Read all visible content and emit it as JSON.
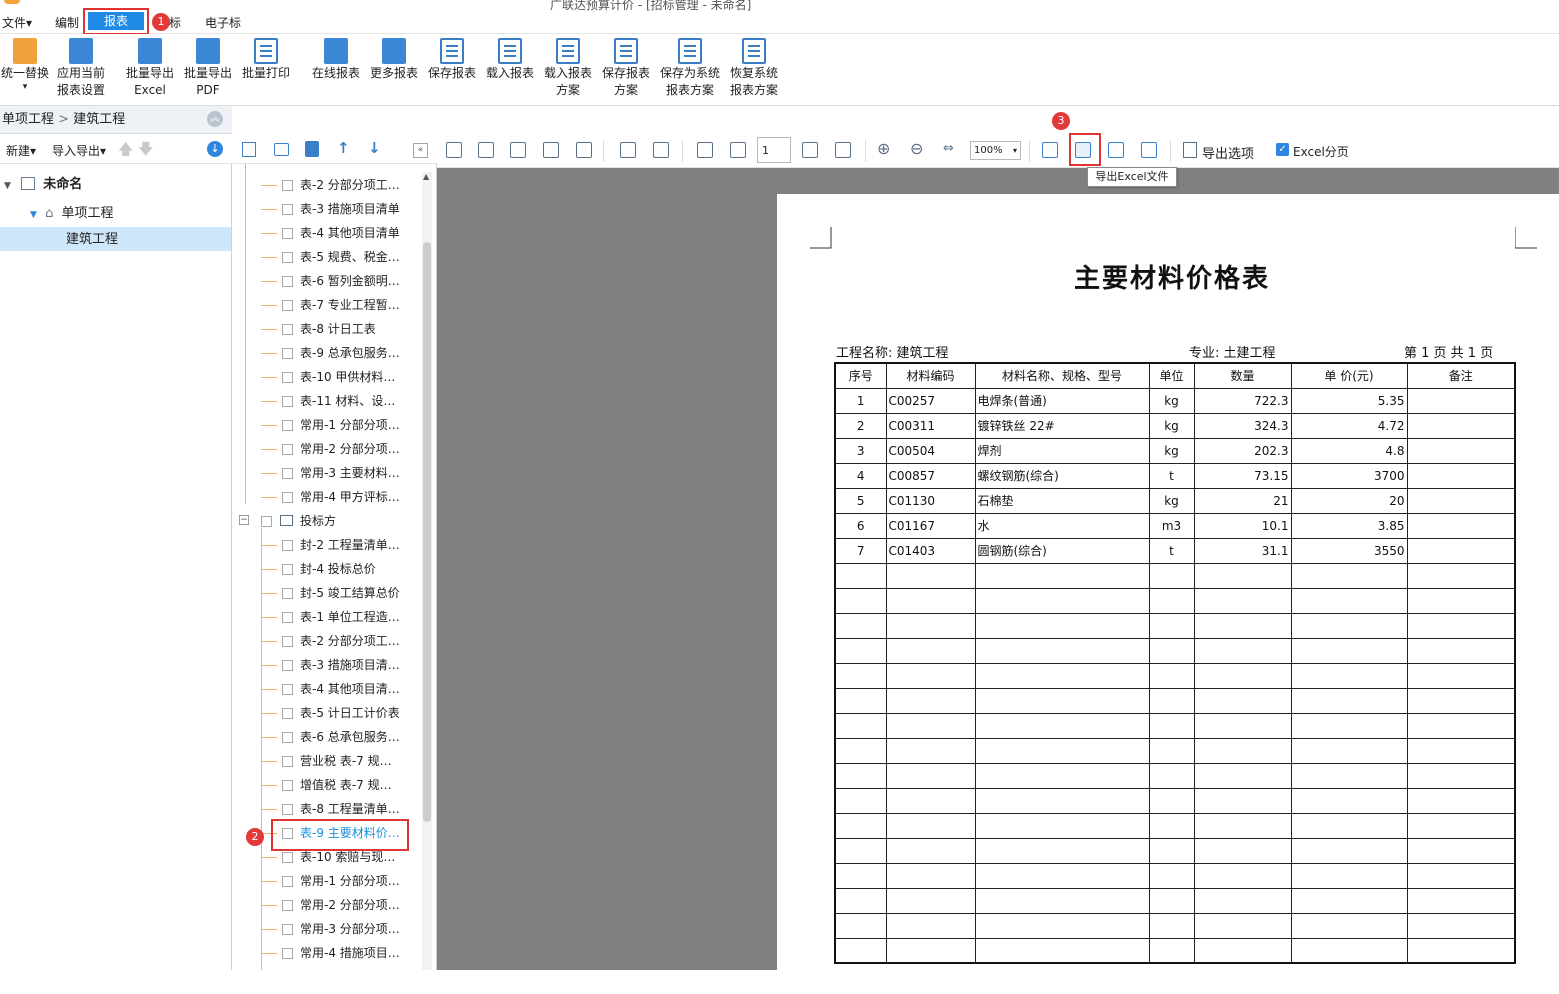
{
  "menu": {
    "items": [
      "文件▾",
      "编制",
      "报表",
      "标",
      "电子标"
    ],
    "active": "报表",
    "window_title": "广联达预算计价 - [招标管理 - 未命名]"
  },
  "badges": [
    "1",
    "2",
    "3"
  ],
  "ribbon": {
    "buttons": [
      {
        "label1": "统一替换",
        "label2": "▾",
        "icon": "replace-icon"
      },
      {
        "label1": "应用当前",
        "label2": "报表设置",
        "icon": "apply-settings-icon"
      },
      {
        "label1": "批量导出",
        "label2": "Excel",
        "icon": "excel-export-icon"
      },
      {
        "label1": "批量导出",
        "label2": "PDF",
        "icon": "pdf-export-icon"
      },
      {
        "label1": "批量打印",
        "label2": "",
        "icon": "print-icon"
      },
      {
        "label1": "在线报表",
        "label2": "",
        "icon": "online-report-icon"
      },
      {
        "label1": "更多报表",
        "label2": "",
        "icon": "more-reports-icon"
      },
      {
        "label1": "保存报表",
        "label2": "",
        "icon": "save-report-icon"
      },
      {
        "label1": "载入报表",
        "label2": "",
        "icon": "load-report-icon"
      },
      {
        "label1": "载入报表",
        "label2": "方案",
        "icon": "load-scheme-icon"
      },
      {
        "label1": "保存报表",
        "label2": "方案",
        "icon": "save-scheme-icon"
      },
      {
        "label1": "保存为系统",
        "label2": "报表方案",
        "icon": "save-system-scheme-icon"
      },
      {
        "label1": "恢复系统",
        "label2": "报表方案",
        "icon": "restore-system-scheme-icon"
      }
    ]
  },
  "left": {
    "breadcrumb": [
      "单项工程",
      "建筑工程"
    ],
    "toolbar": {
      "new": "新建▾",
      "import_export": "导入导出▾"
    },
    "tree": {
      "root": "未命名",
      "child": "单项工程",
      "leaf": "建筑工程"
    }
  },
  "reports": {
    "items": [
      "表-2 分部分项工…",
      "表-3 措施项目清单",
      "表-4 其他项目清单",
      "表-5 规费、税金…",
      "表-6 暂列金额明…",
      "表-7 专业工程暂…",
      "表-8 计日工表",
      "表-9 总承包服务…",
      "表-10 甲供材料…",
      "表-11 材料、设…",
      "常用-1 分部分项…",
      "常用-2 分部分项…",
      "常用-3 主要材料…",
      "常用-4 甲方评标…"
    ],
    "group": "投标方",
    "group_items": [
      "封-2 工程量清单…",
      "封-4 投标总价",
      "封-5 竣工结算总价",
      "表-1 单位工程造…",
      "表-2 分部分项工…",
      "表-3 措施项目清…",
      "表-4 其他项目清…",
      "表-5 计日工计价表",
      "表-6 总承包服务…",
      "营业税 表-7 规…",
      "增值税 表-7 规…",
      "表-8 工程量清单…",
      "表-9 主要材料价…",
      "表-10 索赔与现…",
      "常用-1 分部分项…",
      "常用-2 分部分项…",
      "常用-3 分部分项…",
      "常用-4 措施项目…"
    ],
    "selected": "表-9 主要材料价…"
  },
  "viewer_toolbar": {
    "page": "1",
    "zoom": "100%",
    "export_options": "导出选项",
    "excel_paging": "Excel分页",
    "tooltip": "导出Excel文件"
  },
  "document": {
    "title": "主要材料价格表",
    "project": "工程名称: 建筑工程",
    "specialty": "专业: 土建工程",
    "page_info": "第 1 页  共 1 页",
    "headers": [
      "序号",
      "材料编码",
      "材料名称、规格、型号",
      "单位",
      "数量",
      "单 价(元)",
      "备注"
    ],
    "rows": [
      [
        "1",
        "C00257",
        "电焊条(普通)",
        "kg",
        "722.3",
        "5.35",
        ""
      ],
      [
        "2",
        "C00311",
        "镀锌铁丝 22#",
        "kg",
        "324.3",
        "4.72",
        ""
      ],
      [
        "3",
        "C00504",
        "焊剂",
        "kg",
        "202.3",
        "4.8",
        ""
      ],
      [
        "4",
        "C00857",
        "螺纹钢筋(综合)",
        "t",
        "73.15",
        "3700",
        ""
      ],
      [
        "5",
        "C01130",
        "石棉垫",
        "kg",
        "21",
        "20",
        ""
      ],
      [
        "6",
        "C01167",
        "水",
        "m3",
        "10.1",
        "3.85",
        ""
      ],
      [
        "7",
        "C01403",
        "圆钢筋(综合)",
        "t",
        "31.1",
        "3550",
        ""
      ]
    ]
  },
  "colors": {
    "accent": "#1f8ae6",
    "highlight": "#e03333",
    "selected_row": "#cde6fa",
    "viewer_bg": "#808080"
  }
}
